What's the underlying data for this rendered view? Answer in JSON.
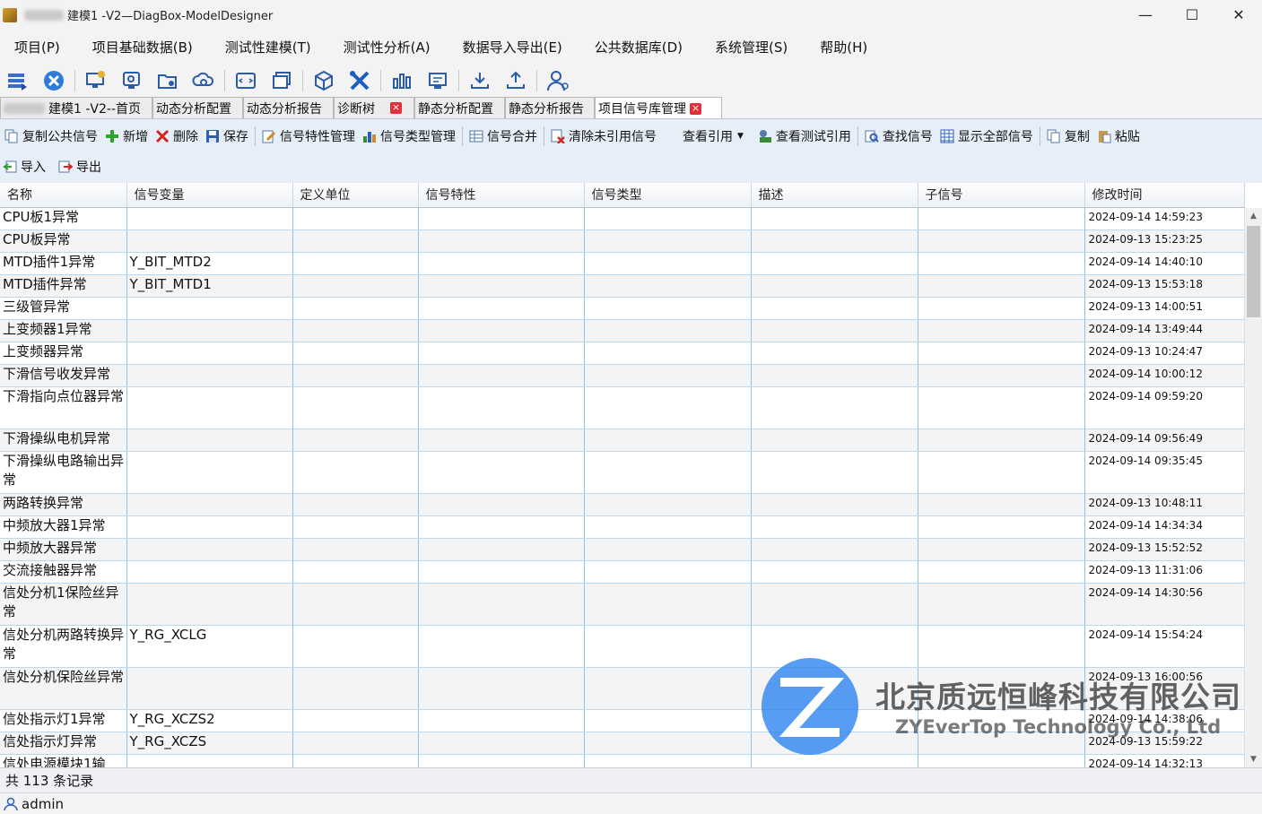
{
  "window": {
    "title": "建模1 -V2—DiagBox-ModelDesigner",
    "minimize_glyph": "—",
    "maximize_glyph": "☐",
    "close_glyph": "✕"
  },
  "menu": [
    "项目(P)",
    "项目基础数据(B)",
    "测试性建模(T)",
    "测试性分析(A)",
    "数据导入导出(E)",
    "公共数据库(D)",
    "系统管理(S)",
    "帮助(H)"
  ],
  "tabs": [
    {
      "label": "建模1 -V2--首页",
      "closable": false,
      "active": false
    },
    {
      "label": "动态分析配置",
      "closable": false,
      "active": false
    },
    {
      "label": "动态分析报告",
      "closable": false,
      "active": false
    },
    {
      "label": "诊断树",
      "closable": true,
      "active": false
    },
    {
      "label": "静态分析配置",
      "closable": false,
      "active": false
    },
    {
      "label": "静态分析报告",
      "closable": false,
      "active": false
    },
    {
      "label": "项目信号库管理",
      "closable": true,
      "active": true
    }
  ],
  "actions": {
    "copy_public": "复制公共信号",
    "add": "新增",
    "delete": "删除",
    "save": "保存",
    "signal_props": "信号特性管理",
    "signal_types": "信号类型管理",
    "merge": "信号合并",
    "clear_unref": "清除未引用信号",
    "view_refs": "查看引用",
    "view_test_refs": "查看测试引用",
    "find": "查找信号",
    "show_all": "显示全部信号",
    "copy": "复制",
    "paste": "粘贴",
    "import": "导入",
    "export": "导出"
  },
  "table": {
    "columns": [
      "名称",
      "信号变量",
      "定义单位",
      "信号特性",
      "信号类型",
      "描述",
      "子信号",
      "修改时间"
    ],
    "rows": [
      {
        "name": "CPU板1异常",
        "var": "",
        "time": "2024-09-14 14:59:23"
      },
      {
        "name": "CPU板异常",
        "var": "",
        "time": "2024-09-13 15:23:25"
      },
      {
        "name": "MTD插件1异常",
        "var": "Y_BIT_MTD2",
        "time": "2024-09-14 14:40:10"
      },
      {
        "name": "MTD插件异常",
        "var": "Y_BIT_MTD1",
        "time": "2024-09-13 15:53:18"
      },
      {
        "name": "三级管异常",
        "var": "",
        "time": "2024-09-13 14:00:51"
      },
      {
        "name": "上变频器1异常",
        "var": "",
        "time": "2024-09-14 13:49:44"
      },
      {
        "name": "上变频器异常",
        "var": "",
        "time": "2024-09-13 10:24:47"
      },
      {
        "name": "下滑信号收发异常",
        "var": "",
        "time": "2024-09-14 10:00:12"
      },
      {
        "name": "下滑指向点位器异常",
        "var": "",
        "time": "2024-09-14 09:59:20"
      },
      {
        "name": "下滑操纵电机异常",
        "var": "",
        "time": "2024-09-14 09:56:49"
      },
      {
        "name": "下滑操纵电路输出异常",
        "var": "",
        "time": "2024-09-14 09:35:45"
      },
      {
        "name": "两路转换异常",
        "var": "",
        "time": "2024-09-13 10:48:11"
      },
      {
        "name": "中频放大器1异常",
        "var": "",
        "time": "2024-09-14 14:34:34"
      },
      {
        "name": "中频放大器异常",
        "var": "",
        "time": "2024-09-13 15:52:52"
      },
      {
        "name": "交流接触器异常",
        "var": "",
        "time": "2024-09-13 11:31:06"
      },
      {
        "name": "信处分机1保险丝异常",
        "var": "",
        "time": "2024-09-14 14:30:56"
      },
      {
        "name": "信处分机两路转换异常",
        "var": "Y_RG_XCLG",
        "time": "2024-09-14 15:54:24"
      },
      {
        "name": "信处分机保险丝异常",
        "var": "",
        "time": "2024-09-13 16:00:56"
      },
      {
        "name": "信处指示灯1异常",
        "var": "Y_RG_XCZS2",
        "time": "2024-09-14 14:38:06"
      },
      {
        "name": "信处指示灯异常",
        "var": "Y_RG_XCZS",
        "time": "2024-09-13 15:59:22"
      },
      {
        "name": "信处电源模块1输",
        "var": "",
        "time": "2024-09-14 14:32:13"
      }
    ]
  },
  "status": {
    "records": "共 113 条记录",
    "user": "admin"
  },
  "watermark": {
    "cn": "北京质远恒峰科技有限公司",
    "en": "ZYEverTop Technology Co., Ltd"
  }
}
